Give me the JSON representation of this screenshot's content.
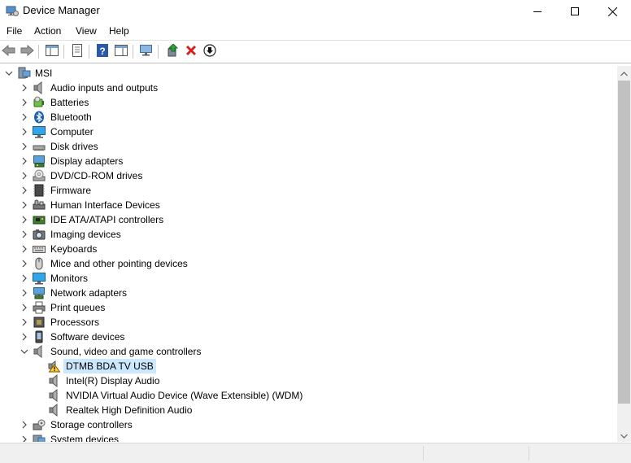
{
  "window": {
    "title": "Device Manager"
  },
  "menu": {
    "items": [
      "File",
      "Action",
      "View",
      "Help"
    ]
  },
  "toolbar": {
    "buttons": [
      "back-icon",
      "forward-icon",
      "show-hide-console-tree-icon",
      "properties-icon",
      "help-icon",
      "action-pane-icon",
      "scan-hardware-changes-icon",
      "update-driver-icon",
      "uninstall-device-icon",
      "disable-device-icon"
    ]
  },
  "tree": {
    "root": {
      "label": "MSI",
      "expanded": true
    },
    "categories": [
      {
        "label": "Audio inputs and outputs",
        "icon": "speaker-icon"
      },
      {
        "label": "Batteries",
        "icon": "battery-icon"
      },
      {
        "label": "Bluetooth",
        "icon": "bluetooth-icon"
      },
      {
        "label": "Computer",
        "icon": "computer-icon"
      },
      {
        "label": "Disk drives",
        "icon": "disk-drive-icon"
      },
      {
        "label": "Display adapters",
        "icon": "display-adapter-icon"
      },
      {
        "label": "DVD/CD-ROM drives",
        "icon": "dvd-drive-icon"
      },
      {
        "label": "Firmware",
        "icon": "firmware-icon"
      },
      {
        "label": "Human Interface Devices",
        "icon": "hid-icon"
      },
      {
        "label": "IDE ATA/ATAPI controllers",
        "icon": "ide-controller-icon"
      },
      {
        "label": "Imaging devices",
        "icon": "camera-icon"
      },
      {
        "label": "Keyboards",
        "icon": "keyboard-icon"
      },
      {
        "label": "Mice and other pointing devices",
        "icon": "mouse-icon"
      },
      {
        "label": "Monitors",
        "icon": "monitor-icon"
      },
      {
        "label": "Network adapters",
        "icon": "network-adapter-icon"
      },
      {
        "label": "Print queues",
        "icon": "printer-icon"
      },
      {
        "label": "Processors",
        "icon": "processor-icon"
      },
      {
        "label": "Software devices",
        "icon": "software-device-icon"
      },
      {
        "label": "Sound, video and game controllers",
        "icon": "speaker-icon",
        "expanded": true,
        "children": [
          {
            "label": "DTMB BDA TV USB",
            "icon": "warning-icon",
            "selected": true
          },
          {
            "label": "Intel(R) Display Audio",
            "icon": "speaker-icon"
          },
          {
            "label": "NVIDIA Virtual Audio Device (Wave Extensible) (WDM)",
            "icon": "speaker-icon"
          },
          {
            "label": "Realtek High Definition Audio",
            "icon": "speaker-icon"
          }
        ]
      },
      {
        "label": "Storage controllers",
        "icon": "storage-controller-icon"
      },
      {
        "label": "System devices",
        "icon": "system-device-icon"
      }
    ]
  }
}
